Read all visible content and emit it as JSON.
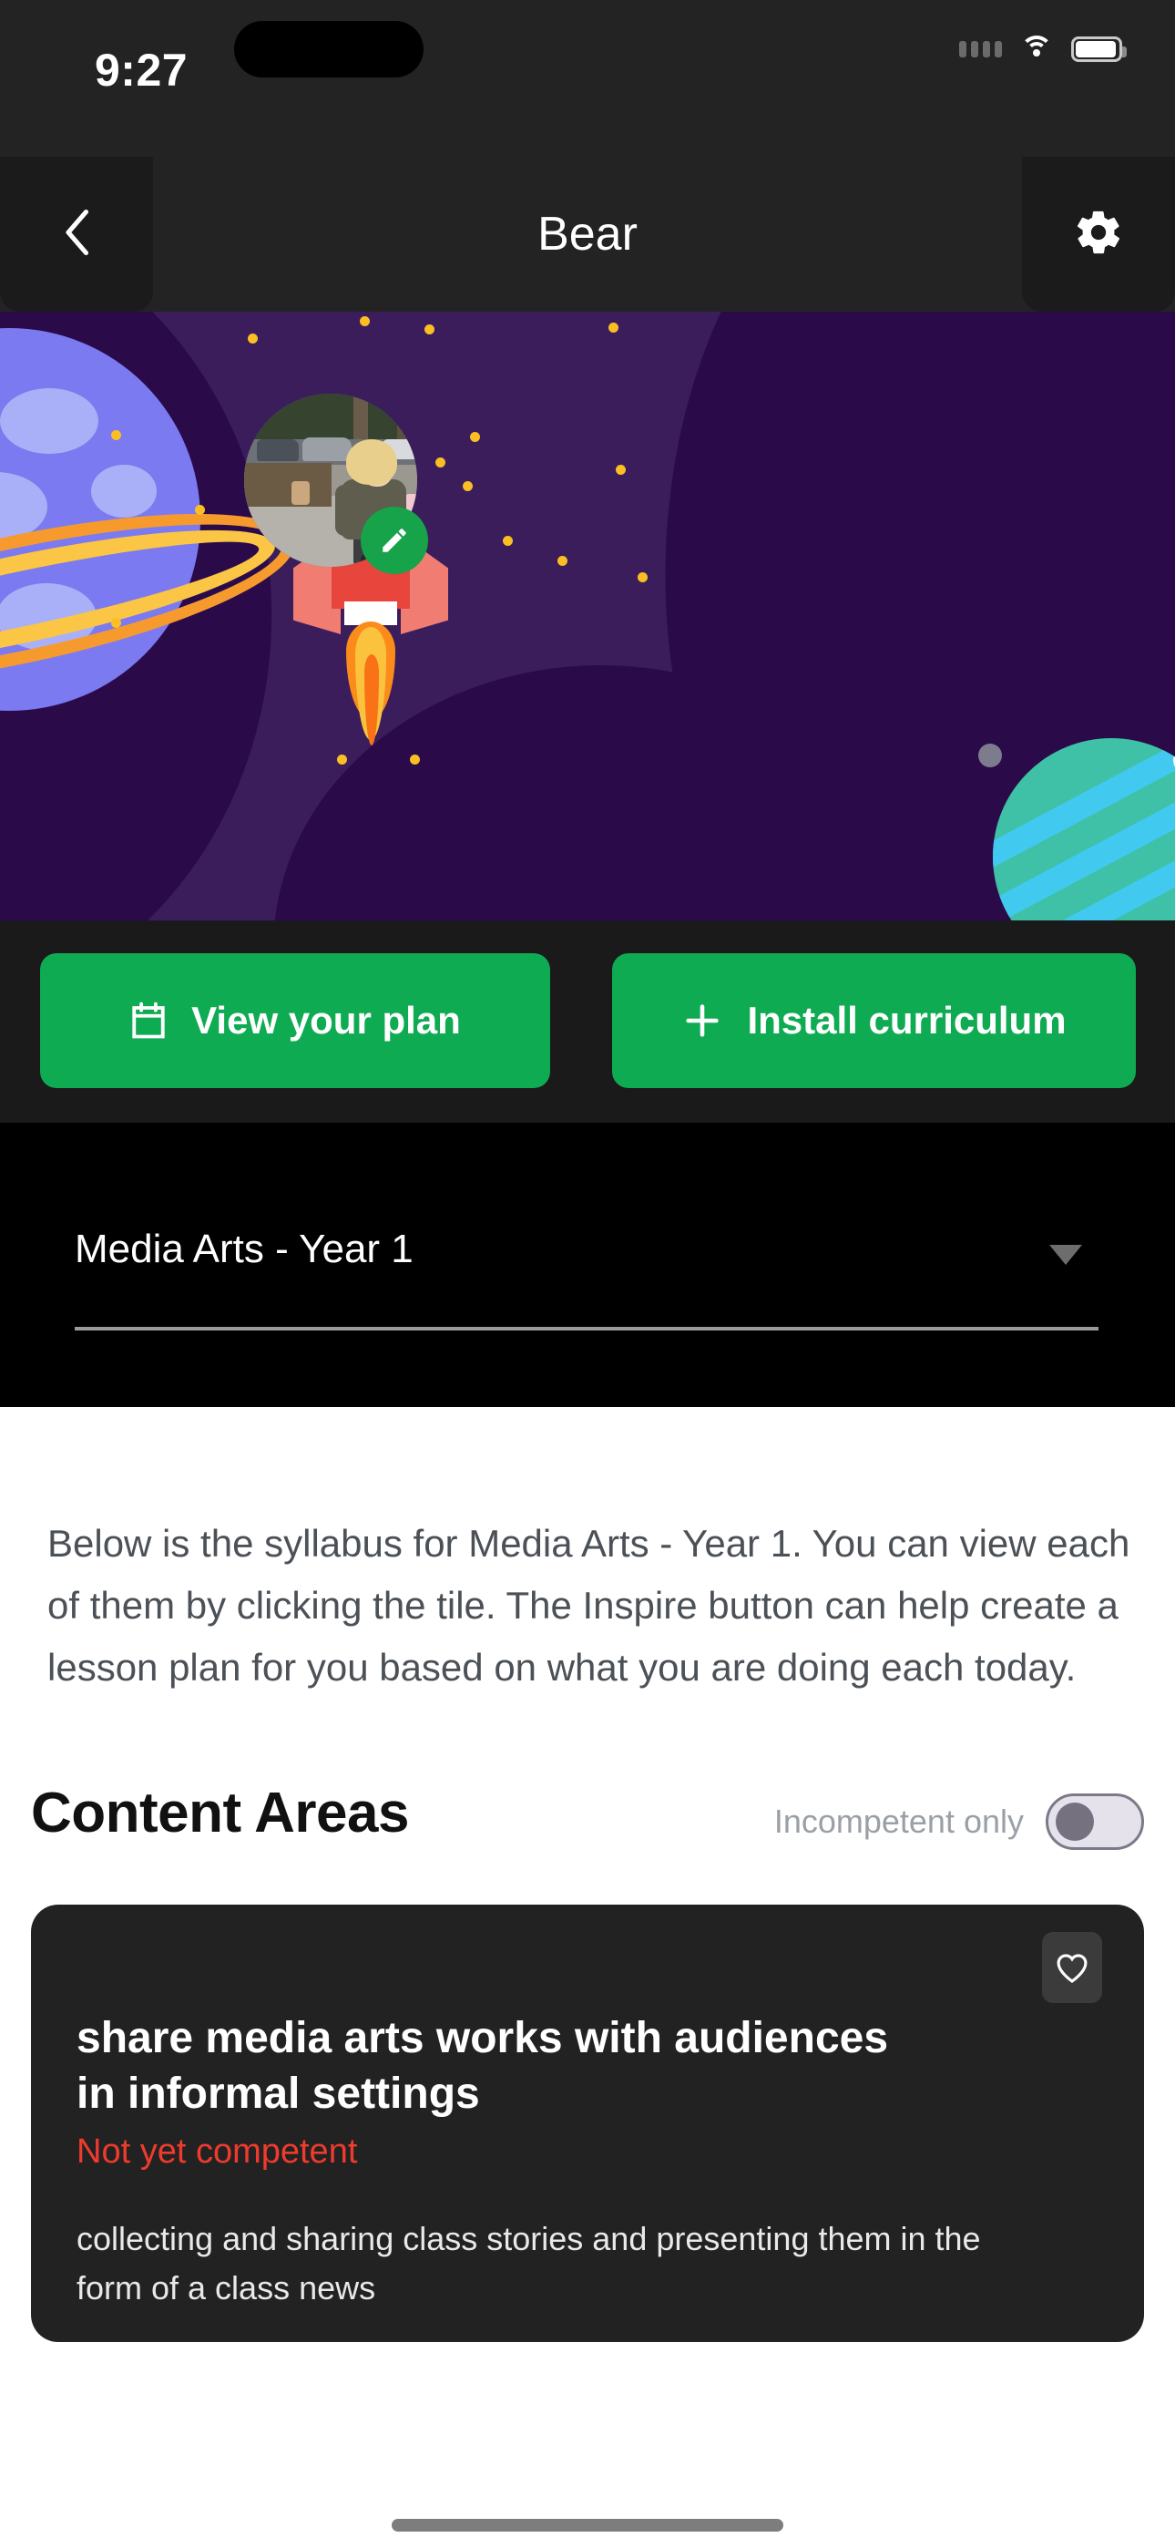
{
  "status_bar": {
    "time": "9:27",
    "signal_icon": "signal-dots-icon",
    "wifi_icon": "wifi-icon",
    "battery_icon": "battery-icon"
  },
  "nav": {
    "back_icon": "chevron-left-icon",
    "title": "Bear",
    "settings_icon": "gear-icon"
  },
  "hero": {
    "avatar_alt": "child photo avatar",
    "edit_icon": "pencil-icon",
    "rocket_icon": "rocket-illustration",
    "planet_left_icon": "ringed-planet-illustration",
    "planet_right_icon": "striped-planet-illustration"
  },
  "actions": {
    "view_plan": {
      "label": "View your plan",
      "icon": "calendar-icon"
    },
    "install_curriculum": {
      "label": "Install curriculum",
      "icon": "plus-icon"
    }
  },
  "course_select": {
    "value": "Media Arts - Year 1",
    "caret_icon": "chevron-down-icon"
  },
  "intro_text": "Below is the syllabus for Media Arts - Year 1. You can view each of them by clicking the tile. The Inspire button can help create a lesson plan for you based on what you are doing each today.",
  "section": {
    "title": "Content Areas",
    "toggle_label": "Incompetent only",
    "toggle_state": "off"
  },
  "cards": [
    {
      "title": "share media arts works with audiences in informal settings",
      "status": "Not yet competent",
      "status_color": "#ef3b2d",
      "description": "collecting and sharing class stories and presenting them in the form of a class news",
      "favorite_icon": "heart-icon"
    }
  ],
  "colors": {
    "accent_green": "#0fab53",
    "status_red": "#ef3b2d",
    "hero_purple": "#3b1d5c",
    "dark_panel": "#232323"
  }
}
